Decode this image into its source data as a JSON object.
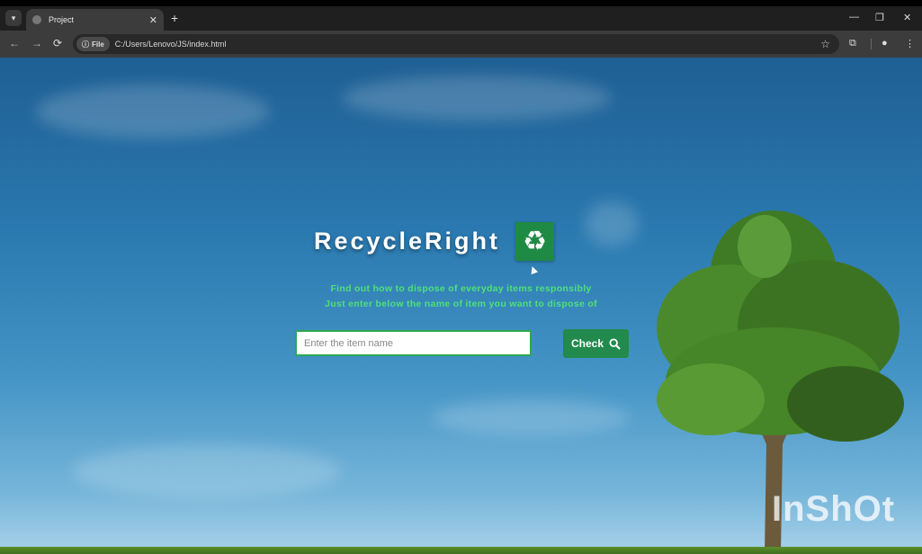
{
  "browser": {
    "tab_title": "Project",
    "tab_close": "✕",
    "new_tab": "+",
    "back": "←",
    "forward": "→",
    "reload": "⟳",
    "file_chip": "File",
    "url": "C:/Users/Lenovo/JS/index.html",
    "minimize": "—",
    "restore": "❐",
    "close": "✕"
  },
  "page": {
    "title": "RecycleRight",
    "logo_symbol": "♻",
    "tagline_1": "Find out how to dispose of everyday items responsibly",
    "tagline_2": "Just enter below the name of item you want to dispose of",
    "input_placeholder": "Enter the item name",
    "check_label": "Check"
  },
  "watermark": "InShOt",
  "colors": {
    "accent_green": "#218a4c",
    "tagline_green": "#4fe07a",
    "input_border": "#2da84f"
  }
}
